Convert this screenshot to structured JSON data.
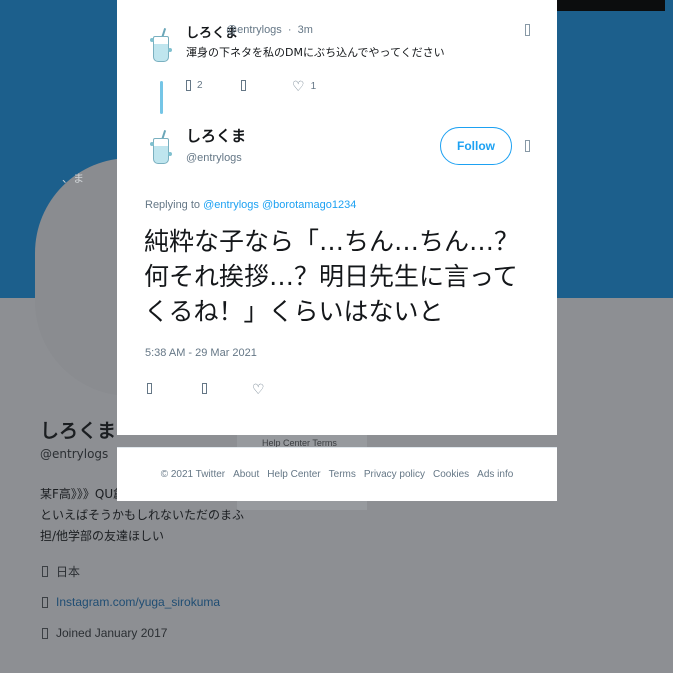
{
  "profile": {
    "avatar_snippet": "、ま",
    "name": "しろくま",
    "handle": "@entrylogs",
    "bio_lines": [
      "某F高》》》QU創薬",
      "といえばそうかもしれないただのまふ",
      "担/他学部の友達ほしい"
    ],
    "location": "日本",
    "link": "Instagram.com/yuga_sirokuma",
    "joined": "Joined January 2017",
    "side_links": "Help Center   Terms"
  },
  "reply_tweet": {
    "name": "しろくま",
    "handle": "@entrylogs",
    "separator": "·",
    "age": "3m",
    "text": "渾身の下ネタを私のDMにぶち込んでやってください",
    "reply_count": "2",
    "like_count": "1"
  },
  "main_tweet": {
    "name": "しろくま",
    "handle": "@entrylogs",
    "follow_label": "Follow",
    "replying_prefix": "Replying to",
    "mention_1": "@entrylogs",
    "mention_2": "@borotamago1234",
    "text": "純粋な子なら「…ちん…ちん…？何それ挨拶…？明日先生に言ってくるね！」くらいはないと",
    "timestamp": "5:38 AM - 29 Mar 2021"
  },
  "footer": {
    "links": [
      "© 2021 Twitter",
      "About",
      "Help Center",
      "Terms",
      "Privacy policy",
      "Cookies",
      "Ads info"
    ]
  },
  "colors": {
    "banner": "#1c5f8c",
    "accent": "#1da1f2",
    "thread_line": "#75c5e6",
    "overlay_gray": "#8d8f93"
  },
  "icons": [
    "chevron-down-icon",
    "reply-icon",
    "retweet-icon",
    "heart-icon",
    "location-icon",
    "link-icon",
    "calendar-icon"
  ]
}
